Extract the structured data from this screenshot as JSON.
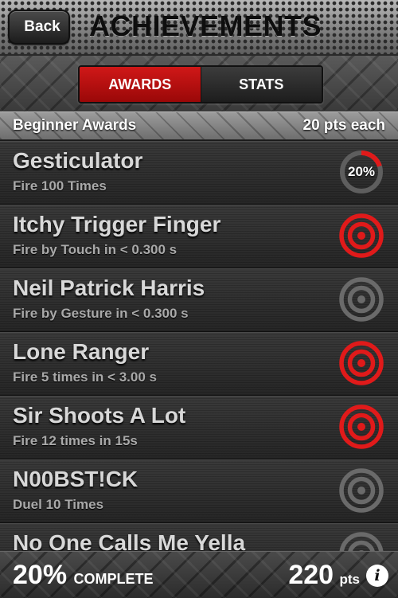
{
  "header": {
    "back_label": "Back",
    "title": "ACHIEVEMENTS"
  },
  "tabs": [
    {
      "label": "AWARDS",
      "active": true
    },
    {
      "label": "STATS",
      "active": false
    }
  ],
  "section": {
    "title": "Beginner Awards",
    "points": "20 pts each"
  },
  "achievements": [
    {
      "title": "Gesticulator",
      "subtitle": "Fire 100 Times",
      "status": "in-progress",
      "progress_label": "20%",
      "progress": 0.2
    },
    {
      "title": "Itchy Trigger Finger",
      "subtitle": "Fire by Touch in < 0.300 s",
      "status": "earned"
    },
    {
      "title": "Neil Patrick Harris",
      "subtitle": "Fire by Gesture in < 0.300 s",
      "status": "locked"
    },
    {
      "title": "Lone Ranger",
      "subtitle": "Fire 5 times in < 3.00 s",
      "status": "earned"
    },
    {
      "title": "Sir Shoots A Lot",
      "subtitle": "Fire 12 times in 15s",
      "status": "earned"
    },
    {
      "title": "N00BST!CK",
      "subtitle": "Duel 10 Times",
      "status": "locked"
    },
    {
      "title": "No One Calls Me Yella",
      "subtitle": "",
      "status": "locked"
    }
  ],
  "footer": {
    "percent": "20%",
    "complete_label": "COMPLETE",
    "points": "220",
    "points_label": "pts",
    "info_icon": "i"
  },
  "colors": {
    "accent_red": "#e01a1a",
    "locked_gray": "#6a6a6a"
  }
}
